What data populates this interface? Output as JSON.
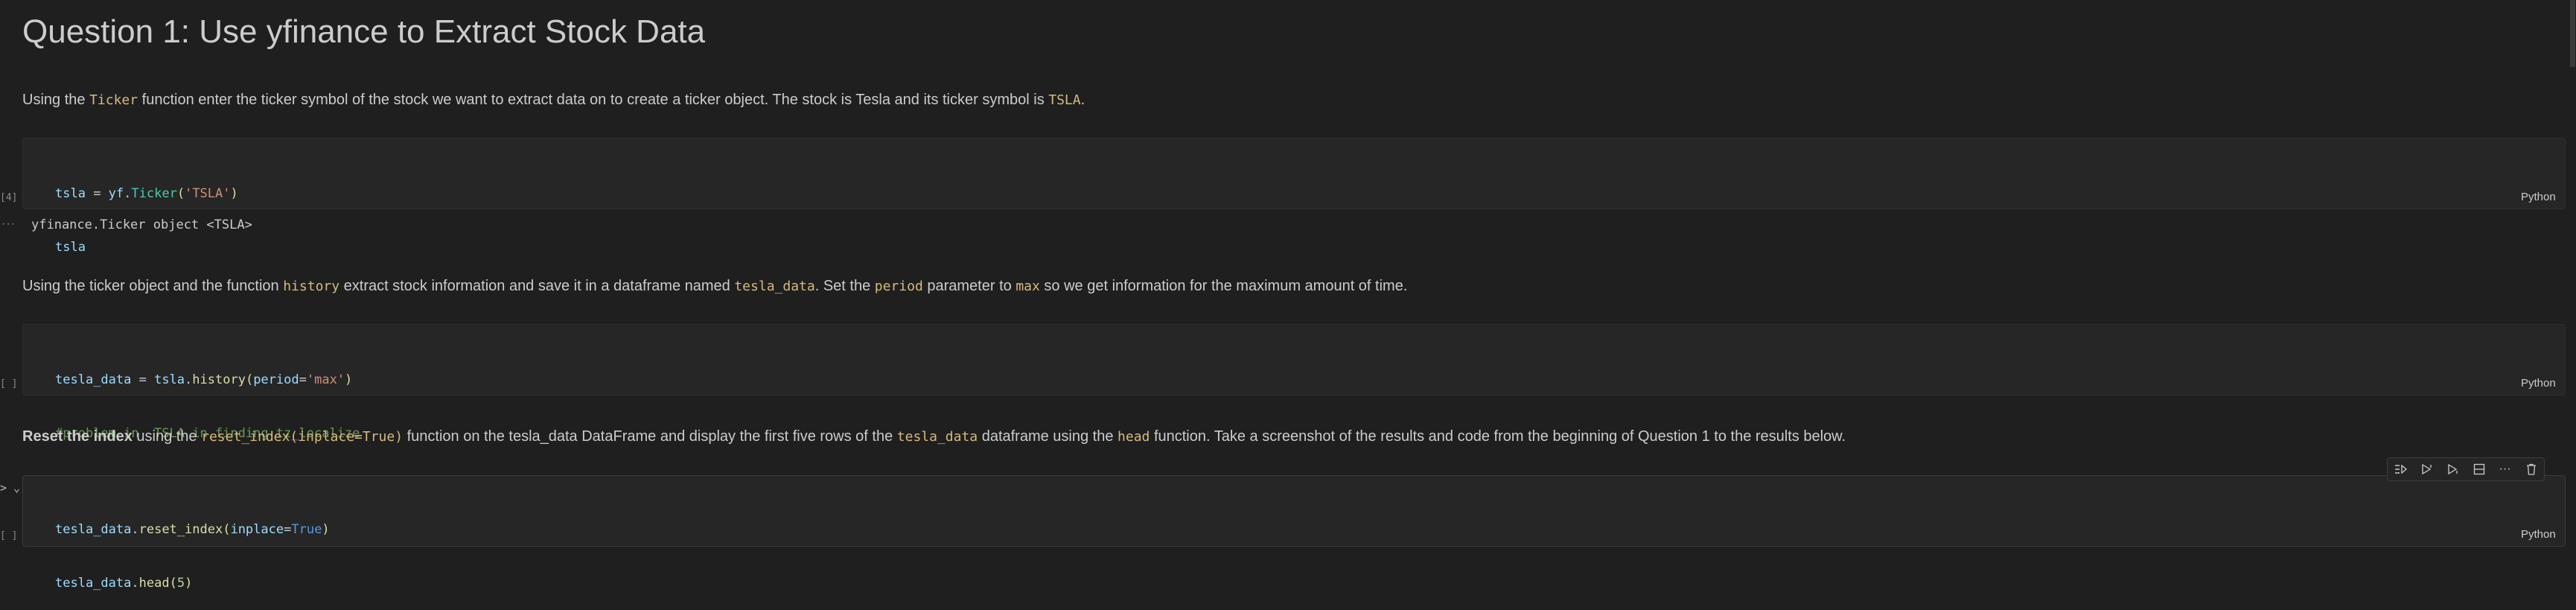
{
  "heading": "Question 1: Use yfinance to Extract Stock Data",
  "md1": {
    "p1": "Using the ",
    "c1": "Ticker",
    "p2": " function enter the ticker symbol of the stock we want to extract data on to create a ticker object. The stock is Tesla and its ticker symbol is ",
    "c2": "TSLA",
    "p3": "."
  },
  "cell1": {
    "exec": "[4]",
    "line1": {
      "var": "tsla",
      "eq": " = ",
      "mod": "yf",
      "dot": ".",
      "cls": "Ticker",
      "open": "(",
      "str": "'TSLA'",
      "close": ")"
    },
    "line2": "tsla",
    "lang": "Python",
    "output_marker": "···",
    "output": "yfinance.Ticker object <TSLA>"
  },
  "md2": {
    "p1": "Using the ticker object and the function ",
    "c1": "history",
    "p2": " extract stock information and save it in a dataframe named ",
    "c2": "tesla_data",
    "p3": ". Set the ",
    "c3": "period",
    "p4": " parameter to ",
    "c4": "max",
    "p5": " so we get information for the maximum amount of time."
  },
  "cell2": {
    "exec": "[ ]",
    "line1": {
      "var": "tesla_data",
      "eq": " = ",
      "obj": "tsla",
      "dot": ".",
      "fn": "history",
      "open": "(",
      "param": "period",
      "pe": "=",
      "str": "'max'",
      "close": ")"
    },
    "line2": "#problem in  TSLA in finding tz_localize",
    "lang": "Python"
  },
  "md3": {
    "bold": "Reset the index",
    "p1": " using the ",
    "c1": "reset_index(inplace=True)",
    "p2": " function on the tesla_data DataFrame and display the first five rows of the ",
    "c2": "tesla_data",
    "p3": " dataframe using the ",
    "c3": "head",
    "p4": " function. Take a screenshot of the results and code from the beginning of Question 1 to the results below."
  },
  "cell3": {
    "exec": "[ ]",
    "run_marker": "> ⌄",
    "line1": {
      "obj": "tesla_data",
      "dot": ".",
      "fn": "reset_index",
      "open": "(",
      "param": "inplace",
      "pe": "=",
      "const": "True",
      "close": ")"
    },
    "line2": {
      "obj": "tesla_data",
      "dot": ".",
      "fn": "head",
      "open": "(",
      "num": "5",
      "close": ")"
    },
    "lang": "Python"
  },
  "toolbar": {
    "icons": [
      "run-by-line-icon",
      "execute-above-icon",
      "execute-below-icon",
      "split-cell-icon",
      "more-icon",
      "delete-icon"
    ],
    "more": "···"
  }
}
